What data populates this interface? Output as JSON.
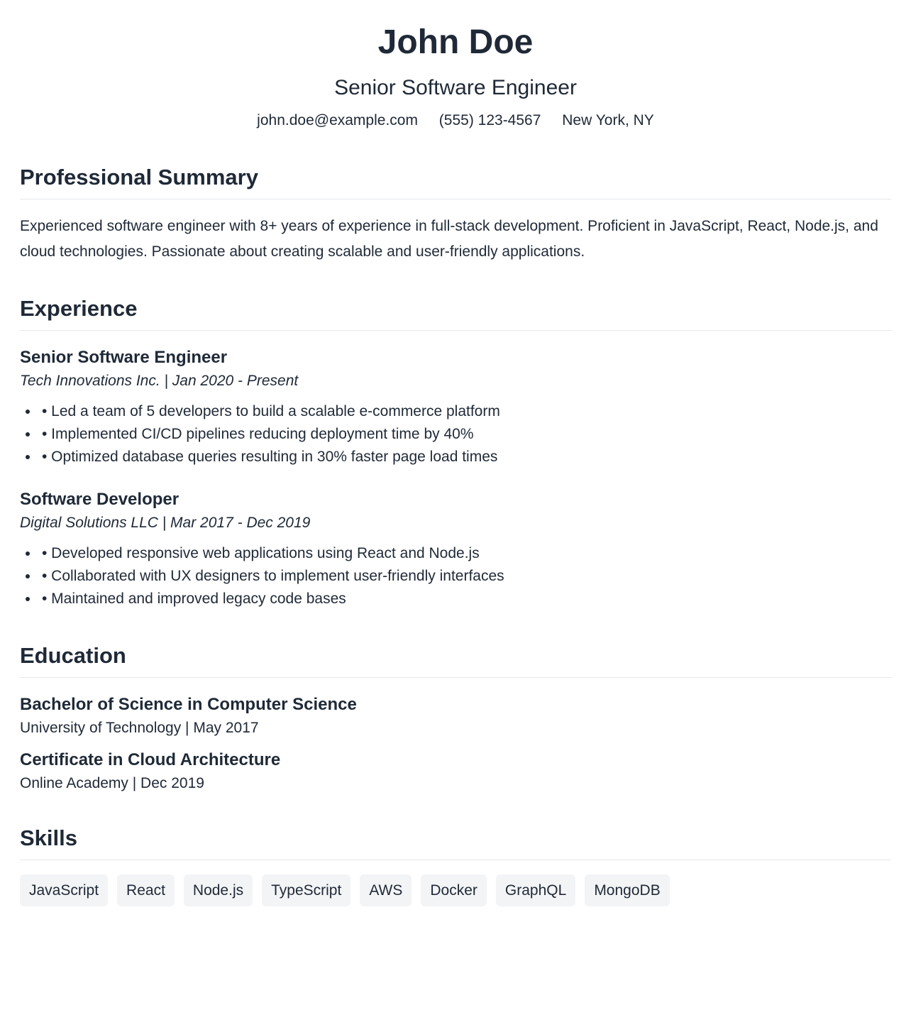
{
  "header": {
    "name": "John Doe",
    "title": "Senior Software Engineer",
    "email": "john.doe@example.com",
    "phone": "(555) 123-4567",
    "location": "New York, NY"
  },
  "summary": {
    "heading": "Professional Summary",
    "text": "Experienced software engineer with 8+ years of experience in full-stack development. Proficient in JavaScript, React, Node.js, and cloud technologies. Passionate about creating scalable and user-friendly applications."
  },
  "experience": {
    "heading": "Experience",
    "jobs": [
      {
        "title": "Senior Software Engineer",
        "meta": "Tech Innovations Inc. | Jan 2020 - Present",
        "bullets": [
          "• Led a team of 5 developers to build a scalable e-commerce platform",
          "• Implemented CI/CD pipelines reducing deployment time by 40%",
          "• Optimized database queries resulting in 30% faster page load times"
        ]
      },
      {
        "title": "Software Developer",
        "meta": "Digital Solutions LLC | Mar 2017 - Dec 2019",
        "bullets": [
          "• Developed responsive web applications using React and Node.js",
          "• Collaborated with UX designers to implement user-friendly interfaces",
          "• Maintained and improved legacy code bases"
        ]
      }
    ]
  },
  "education": {
    "heading": "Education",
    "items": [
      {
        "degree": "Bachelor of Science in Computer Science",
        "meta": "University of Technology | May 2017"
      },
      {
        "degree": "Certificate in Cloud Architecture",
        "meta": "Online Academy | Dec 2019"
      }
    ]
  },
  "skills": {
    "heading": "Skills",
    "items": [
      "JavaScript",
      "React",
      "Node.js",
      "TypeScript",
      "AWS",
      "Docker",
      "GraphQL",
      "MongoDB"
    ]
  }
}
